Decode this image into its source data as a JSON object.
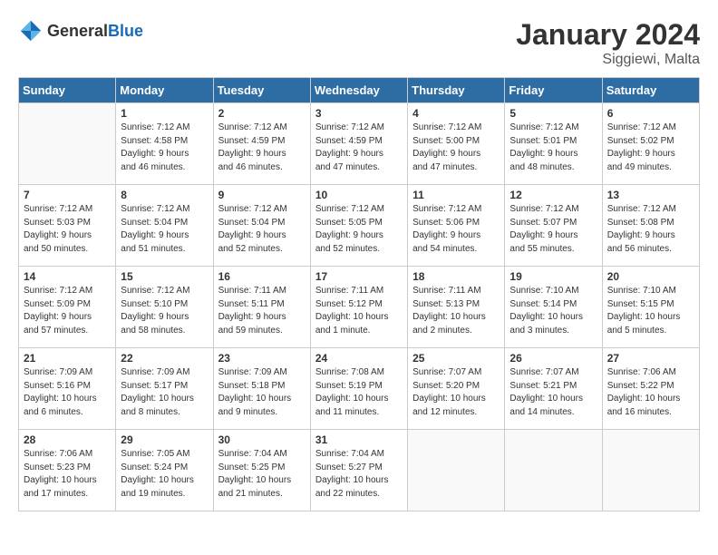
{
  "logo": {
    "general": "General",
    "blue": "Blue"
  },
  "title": "January 2024",
  "location": "Siggiewi, Malta",
  "days_header": [
    "Sunday",
    "Monday",
    "Tuesday",
    "Wednesday",
    "Thursday",
    "Friday",
    "Saturday"
  ],
  "weeks": [
    [
      {
        "day": "",
        "info": ""
      },
      {
        "day": "1",
        "info": "Sunrise: 7:12 AM\nSunset: 4:58 PM\nDaylight: 9 hours\nand 46 minutes."
      },
      {
        "day": "2",
        "info": "Sunrise: 7:12 AM\nSunset: 4:59 PM\nDaylight: 9 hours\nand 46 minutes."
      },
      {
        "day": "3",
        "info": "Sunrise: 7:12 AM\nSunset: 4:59 PM\nDaylight: 9 hours\nand 47 minutes."
      },
      {
        "day": "4",
        "info": "Sunrise: 7:12 AM\nSunset: 5:00 PM\nDaylight: 9 hours\nand 47 minutes."
      },
      {
        "day": "5",
        "info": "Sunrise: 7:12 AM\nSunset: 5:01 PM\nDaylight: 9 hours\nand 48 minutes."
      },
      {
        "day": "6",
        "info": "Sunrise: 7:12 AM\nSunset: 5:02 PM\nDaylight: 9 hours\nand 49 minutes."
      }
    ],
    [
      {
        "day": "7",
        "info": "Sunrise: 7:12 AM\nSunset: 5:03 PM\nDaylight: 9 hours\nand 50 minutes."
      },
      {
        "day": "8",
        "info": "Sunrise: 7:12 AM\nSunset: 5:04 PM\nDaylight: 9 hours\nand 51 minutes."
      },
      {
        "day": "9",
        "info": "Sunrise: 7:12 AM\nSunset: 5:04 PM\nDaylight: 9 hours\nand 52 minutes."
      },
      {
        "day": "10",
        "info": "Sunrise: 7:12 AM\nSunset: 5:05 PM\nDaylight: 9 hours\nand 52 minutes."
      },
      {
        "day": "11",
        "info": "Sunrise: 7:12 AM\nSunset: 5:06 PM\nDaylight: 9 hours\nand 54 minutes."
      },
      {
        "day": "12",
        "info": "Sunrise: 7:12 AM\nSunset: 5:07 PM\nDaylight: 9 hours\nand 55 minutes."
      },
      {
        "day": "13",
        "info": "Sunrise: 7:12 AM\nSunset: 5:08 PM\nDaylight: 9 hours\nand 56 minutes."
      }
    ],
    [
      {
        "day": "14",
        "info": "Sunrise: 7:12 AM\nSunset: 5:09 PM\nDaylight: 9 hours\nand 57 minutes."
      },
      {
        "day": "15",
        "info": "Sunrise: 7:12 AM\nSunset: 5:10 PM\nDaylight: 9 hours\nand 58 minutes."
      },
      {
        "day": "16",
        "info": "Sunrise: 7:11 AM\nSunset: 5:11 PM\nDaylight: 9 hours\nand 59 minutes."
      },
      {
        "day": "17",
        "info": "Sunrise: 7:11 AM\nSunset: 5:12 PM\nDaylight: 10 hours\nand 1 minute."
      },
      {
        "day": "18",
        "info": "Sunrise: 7:11 AM\nSunset: 5:13 PM\nDaylight: 10 hours\nand 2 minutes."
      },
      {
        "day": "19",
        "info": "Sunrise: 7:10 AM\nSunset: 5:14 PM\nDaylight: 10 hours\nand 3 minutes."
      },
      {
        "day": "20",
        "info": "Sunrise: 7:10 AM\nSunset: 5:15 PM\nDaylight: 10 hours\nand 5 minutes."
      }
    ],
    [
      {
        "day": "21",
        "info": "Sunrise: 7:09 AM\nSunset: 5:16 PM\nDaylight: 10 hours\nand 6 minutes."
      },
      {
        "day": "22",
        "info": "Sunrise: 7:09 AM\nSunset: 5:17 PM\nDaylight: 10 hours\nand 8 minutes."
      },
      {
        "day": "23",
        "info": "Sunrise: 7:09 AM\nSunset: 5:18 PM\nDaylight: 10 hours\nand 9 minutes."
      },
      {
        "day": "24",
        "info": "Sunrise: 7:08 AM\nSunset: 5:19 PM\nDaylight: 10 hours\nand 11 minutes."
      },
      {
        "day": "25",
        "info": "Sunrise: 7:07 AM\nSunset: 5:20 PM\nDaylight: 10 hours\nand 12 minutes."
      },
      {
        "day": "26",
        "info": "Sunrise: 7:07 AM\nSunset: 5:21 PM\nDaylight: 10 hours\nand 14 minutes."
      },
      {
        "day": "27",
        "info": "Sunrise: 7:06 AM\nSunset: 5:22 PM\nDaylight: 10 hours\nand 16 minutes."
      }
    ],
    [
      {
        "day": "28",
        "info": "Sunrise: 7:06 AM\nSunset: 5:23 PM\nDaylight: 10 hours\nand 17 minutes."
      },
      {
        "day": "29",
        "info": "Sunrise: 7:05 AM\nSunset: 5:24 PM\nDaylight: 10 hours\nand 19 minutes."
      },
      {
        "day": "30",
        "info": "Sunrise: 7:04 AM\nSunset: 5:25 PM\nDaylight: 10 hours\nand 21 minutes."
      },
      {
        "day": "31",
        "info": "Sunrise: 7:04 AM\nSunset: 5:27 PM\nDaylight: 10 hours\nand 22 minutes."
      },
      {
        "day": "",
        "info": ""
      },
      {
        "day": "",
        "info": ""
      },
      {
        "day": "",
        "info": ""
      }
    ]
  ]
}
